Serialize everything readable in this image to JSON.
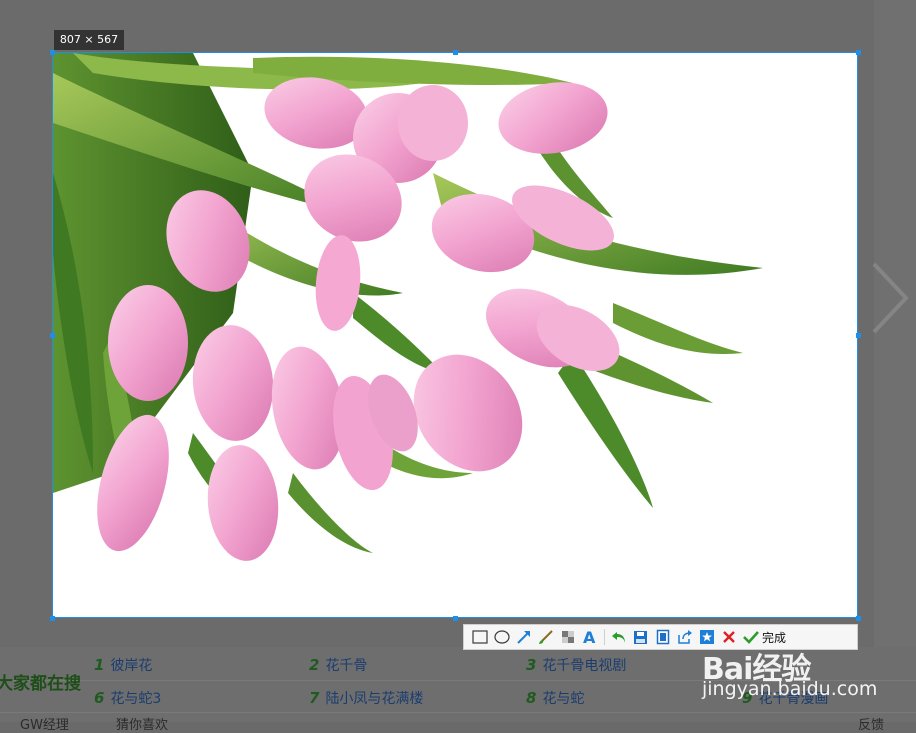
{
  "capture": {
    "dimension_label": "807 × 567"
  },
  "toolbar": {
    "tools": [
      {
        "name": "rectangle-tool",
        "icon": "rectangle-icon"
      },
      {
        "name": "ellipse-tool",
        "icon": "ellipse-icon"
      },
      {
        "name": "arrow-tool",
        "icon": "arrow-icon"
      },
      {
        "name": "brush-tool",
        "icon": "brush-icon"
      },
      {
        "name": "mosaic-tool",
        "icon": "mosaic-icon"
      },
      {
        "name": "text-tool",
        "icon": "text-icon"
      },
      {
        "name": "undo-tool",
        "icon": "undo-icon"
      },
      {
        "name": "save-tool",
        "icon": "save-icon"
      },
      {
        "name": "copy-tool",
        "icon": "copy-icon"
      },
      {
        "name": "share-tool",
        "icon": "share-icon"
      },
      {
        "name": "favorite-tool",
        "icon": "star-icon"
      },
      {
        "name": "cancel-tool",
        "icon": "close-icon"
      }
    ],
    "done_label": "完成",
    "colors": {
      "accent": "#1e8fe8",
      "cancel": "#e02020",
      "done": "#2a9d2a"
    }
  },
  "background_page": {
    "search_heading": "大家都在搜",
    "hot_searches": [
      {
        "num": "1",
        "text": "彼岸花"
      },
      {
        "num": "2",
        "text": "花千骨"
      },
      {
        "num": "3",
        "text": "花千骨电视剧"
      },
      {
        "num": "6",
        "text": "花与蛇3"
      },
      {
        "num": "7",
        "text": "陆小凤与花满楼"
      },
      {
        "num": "8",
        "text": "花与蛇"
      },
      {
        "num": "9",
        "text": "花千骨漫画"
      }
    ],
    "partial_left": "GW经理",
    "partial_mid": "猜你喜欢",
    "partial_right": "反馈"
  },
  "watermark": {
    "logo": "Bai经验",
    "url": "jingyan.baidu.com"
  }
}
